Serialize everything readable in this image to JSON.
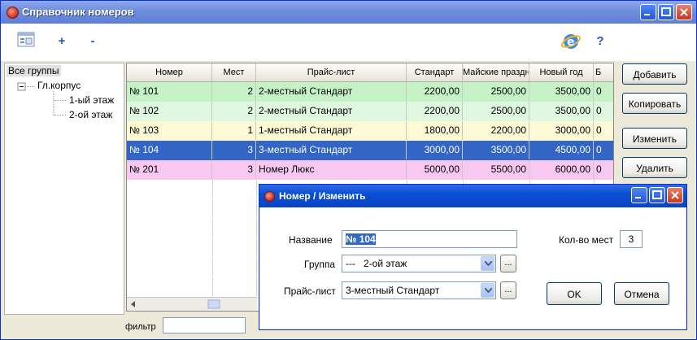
{
  "window": {
    "title": "Справочник номеров"
  },
  "tree": {
    "root": "Все группы",
    "building": "Гл.корпус",
    "floors": [
      "1-ый этаж",
      "2-ой этаж"
    ]
  },
  "grid": {
    "columns": [
      "Номер",
      "Мест",
      "Прайс-лист",
      "Стандарт",
      "Майские праздн",
      "Новый год",
      "Б"
    ],
    "rows": [
      {
        "num": "№ 101",
        "seats": "2",
        "price_list": "2-местный Стандарт",
        "standard": "2200,00",
        "may": "2500,00",
        "new_year": "3500,00",
        "extra": "0"
      },
      {
        "num": "№ 102",
        "seats": "2",
        "price_list": "2-местный Стандарт",
        "standard": "2200,00",
        "may": "2500,00",
        "new_year": "3500,00",
        "extra": "0"
      },
      {
        "num": "№ 103",
        "seats": "1",
        "price_list": "1-местный Стандарт",
        "standard": "1800,00",
        "may": "2200,00",
        "new_year": "3000,00",
        "extra": "0"
      },
      {
        "num": "№ 104",
        "seats": "3",
        "price_list": "3-местный Стандарт",
        "standard": "3000,00",
        "may": "3500,00",
        "new_year": "4500,00",
        "extra": "0"
      },
      {
        "num": "№ 201",
        "seats": "3",
        "price_list": "Номер Люкс",
        "standard": "5000,00",
        "may": "5500,00",
        "new_year": "6000,00",
        "extra": "0"
      }
    ],
    "row_colors": [
      "#c6f3c6",
      "#dff6df",
      "#fdf9d5",
      "#3365c4",
      "#f8c8f0"
    ],
    "selected_color": "#3365c4"
  },
  "buttons": {
    "add": "Добавить",
    "copy": "Копировать",
    "edit": "Изменить",
    "delete": "Удалить"
  },
  "toolbar": {
    "add_symbol": "+",
    "remove_symbol": "-",
    "help_symbol": "?"
  },
  "filter": {
    "label": "фильтр",
    "value": ""
  },
  "dialog": {
    "title": "Номер / Изменить",
    "name_label": "Название",
    "name_value": "№ 104",
    "group_label": "Группа",
    "group_value": "---   2-ой этаж",
    "price_label": "Прайс-лист",
    "price_value": "3-местный Стандарт",
    "seats_label": "Кол-во мест",
    "seats_value": "3",
    "ellipsis": "...",
    "ok": "OK",
    "cancel": "Отмена"
  }
}
